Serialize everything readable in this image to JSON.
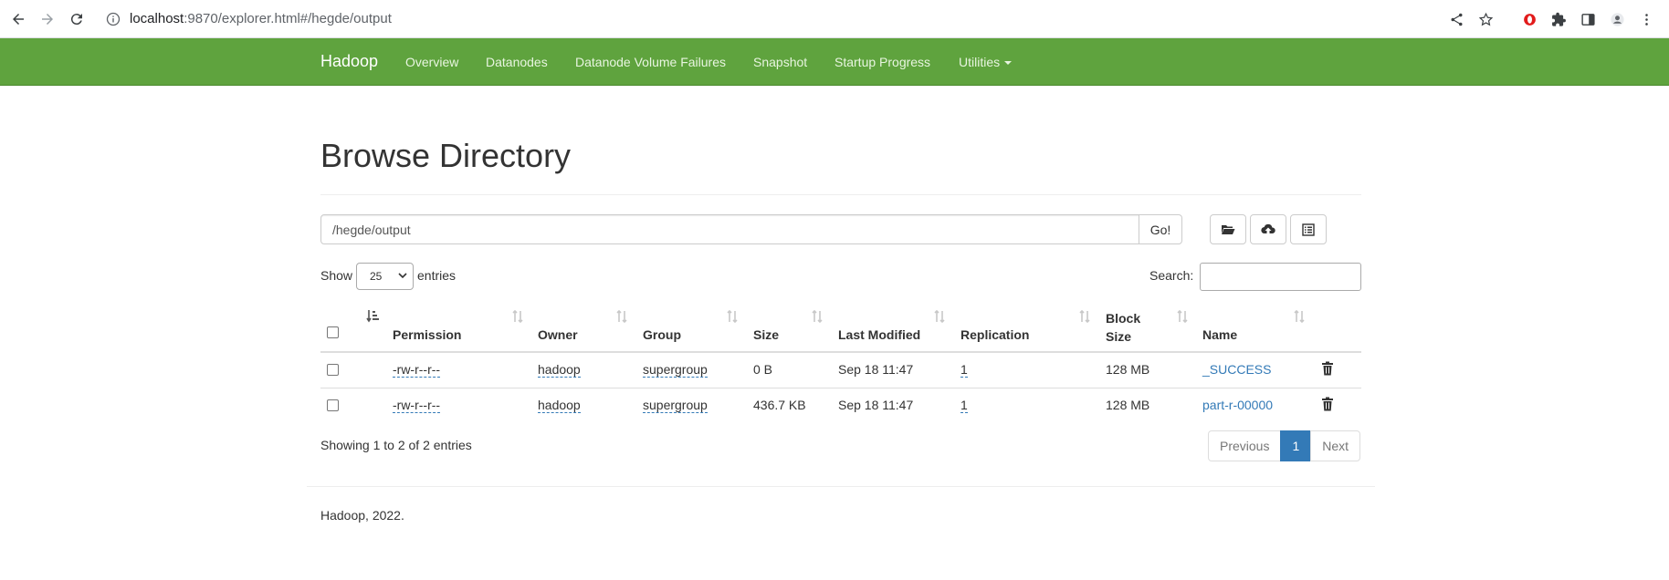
{
  "browser": {
    "url_host": "localhost",
    "url_rest": ":9870/explorer.html#/hegde/output"
  },
  "navbar": {
    "brand": "Hadoop",
    "items": [
      "Overview",
      "Datanodes",
      "Datanode Volume Failures",
      "Snapshot",
      "Startup Progress",
      "Utilities"
    ],
    "color": "#5fa33e"
  },
  "page": {
    "title": "Browse Directory",
    "path_value": "/hegde/output",
    "go_label": "Go!",
    "tool_icons": [
      "folder-open-icon",
      "cloud-upload-icon",
      "list-alt-icon"
    ]
  },
  "table_controls": {
    "show_label": "Show",
    "entries_value": "25",
    "entries_label": "entries",
    "search_label": "Search:"
  },
  "table": {
    "headers": [
      "Permission",
      "Owner",
      "Group",
      "Size",
      "Last Modified",
      "Replication",
      "Block",
      "Size",
      "Name"
    ],
    "rows": [
      {
        "permission": "-rw-r--r--",
        "owner": "hadoop",
        "group": "supergroup",
        "size": "0 B",
        "modified": "Sep 18 11:47",
        "replication": "1",
        "block_size": "128 MB",
        "name": "_SUCCESS"
      },
      {
        "permission": "-rw-r--r--",
        "owner": "hadoop",
        "group": "supergroup",
        "size": "436.7 KB",
        "modified": "Sep 18 11:47",
        "replication": "1",
        "block_size": "128 MB",
        "name": "part-r-00000"
      }
    ]
  },
  "pagination": {
    "info": "Showing 1 to 2 of 2 entries",
    "previous": "Previous",
    "current": "1",
    "next": "Next",
    "active_color": "#337ab7"
  },
  "footer": {
    "text": "Hadoop, 2022."
  }
}
